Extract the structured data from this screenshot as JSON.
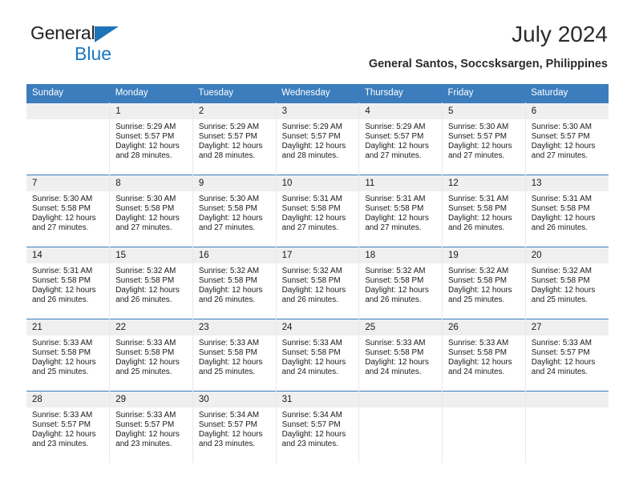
{
  "brand": {
    "name_part1": "General",
    "name_part2": "Blue",
    "triangle_color": "#1f73b7",
    "blue_color": "#1878c4"
  },
  "header": {
    "title": "July 2024",
    "subtitle": "General Santos, Soccsksargen, Philippines"
  },
  "theme": {
    "header_bg": "#3b7dbd",
    "header_text": "#ffffff",
    "daynum_bg": "#efefef",
    "row_border": "#3b7dbd"
  },
  "calendar": {
    "weekdays": [
      "Sunday",
      "Monday",
      "Tuesday",
      "Wednesday",
      "Thursday",
      "Friday",
      "Saturday"
    ],
    "labels": {
      "sunrise": "Sunrise:",
      "sunset": "Sunset:",
      "daylight": "Daylight:"
    },
    "weeks": [
      [
        {
          "day": "",
          "empty": true
        },
        {
          "day": "1",
          "sunrise": "Sunrise: 5:29 AM",
          "sunset": "Sunset: 5:57 PM",
          "daylight": "Daylight: 12 hours and 28 minutes."
        },
        {
          "day": "2",
          "sunrise": "Sunrise: 5:29 AM",
          "sunset": "Sunset: 5:57 PM",
          "daylight": "Daylight: 12 hours and 28 minutes."
        },
        {
          "day": "3",
          "sunrise": "Sunrise: 5:29 AM",
          "sunset": "Sunset: 5:57 PM",
          "daylight": "Daylight: 12 hours and 28 minutes."
        },
        {
          "day": "4",
          "sunrise": "Sunrise: 5:29 AM",
          "sunset": "Sunset: 5:57 PM",
          "daylight": "Daylight: 12 hours and 27 minutes."
        },
        {
          "day": "5",
          "sunrise": "Sunrise: 5:30 AM",
          "sunset": "Sunset: 5:57 PM",
          "daylight": "Daylight: 12 hours and 27 minutes."
        },
        {
          "day": "6",
          "sunrise": "Sunrise: 5:30 AM",
          "sunset": "Sunset: 5:57 PM",
          "daylight": "Daylight: 12 hours and 27 minutes."
        }
      ],
      [
        {
          "day": "7",
          "sunrise": "Sunrise: 5:30 AM",
          "sunset": "Sunset: 5:58 PM",
          "daylight": "Daylight: 12 hours and 27 minutes."
        },
        {
          "day": "8",
          "sunrise": "Sunrise: 5:30 AM",
          "sunset": "Sunset: 5:58 PM",
          "daylight": "Daylight: 12 hours and 27 minutes."
        },
        {
          "day": "9",
          "sunrise": "Sunrise: 5:30 AM",
          "sunset": "Sunset: 5:58 PM",
          "daylight": "Daylight: 12 hours and 27 minutes."
        },
        {
          "day": "10",
          "sunrise": "Sunrise: 5:31 AM",
          "sunset": "Sunset: 5:58 PM",
          "daylight": "Daylight: 12 hours and 27 minutes."
        },
        {
          "day": "11",
          "sunrise": "Sunrise: 5:31 AM",
          "sunset": "Sunset: 5:58 PM",
          "daylight": "Daylight: 12 hours and 27 minutes."
        },
        {
          "day": "12",
          "sunrise": "Sunrise: 5:31 AM",
          "sunset": "Sunset: 5:58 PM",
          "daylight": "Daylight: 12 hours and 26 minutes."
        },
        {
          "day": "13",
          "sunrise": "Sunrise: 5:31 AM",
          "sunset": "Sunset: 5:58 PM",
          "daylight": "Daylight: 12 hours and 26 minutes."
        }
      ],
      [
        {
          "day": "14",
          "sunrise": "Sunrise: 5:31 AM",
          "sunset": "Sunset: 5:58 PM",
          "daylight": "Daylight: 12 hours and 26 minutes."
        },
        {
          "day": "15",
          "sunrise": "Sunrise: 5:32 AM",
          "sunset": "Sunset: 5:58 PM",
          "daylight": "Daylight: 12 hours and 26 minutes."
        },
        {
          "day": "16",
          "sunrise": "Sunrise: 5:32 AM",
          "sunset": "Sunset: 5:58 PM",
          "daylight": "Daylight: 12 hours and 26 minutes."
        },
        {
          "day": "17",
          "sunrise": "Sunrise: 5:32 AM",
          "sunset": "Sunset: 5:58 PM",
          "daylight": "Daylight: 12 hours and 26 minutes."
        },
        {
          "day": "18",
          "sunrise": "Sunrise: 5:32 AM",
          "sunset": "Sunset: 5:58 PM",
          "daylight": "Daylight: 12 hours and 26 minutes."
        },
        {
          "day": "19",
          "sunrise": "Sunrise: 5:32 AM",
          "sunset": "Sunset: 5:58 PM",
          "daylight": "Daylight: 12 hours and 25 minutes."
        },
        {
          "day": "20",
          "sunrise": "Sunrise: 5:32 AM",
          "sunset": "Sunset: 5:58 PM",
          "daylight": "Daylight: 12 hours and 25 minutes."
        }
      ],
      [
        {
          "day": "21",
          "sunrise": "Sunrise: 5:33 AM",
          "sunset": "Sunset: 5:58 PM",
          "daylight": "Daylight: 12 hours and 25 minutes."
        },
        {
          "day": "22",
          "sunrise": "Sunrise: 5:33 AM",
          "sunset": "Sunset: 5:58 PM",
          "daylight": "Daylight: 12 hours and 25 minutes."
        },
        {
          "day": "23",
          "sunrise": "Sunrise: 5:33 AM",
          "sunset": "Sunset: 5:58 PM",
          "daylight": "Daylight: 12 hours and 25 minutes."
        },
        {
          "day": "24",
          "sunrise": "Sunrise: 5:33 AM",
          "sunset": "Sunset: 5:58 PM",
          "daylight": "Daylight: 12 hours and 24 minutes."
        },
        {
          "day": "25",
          "sunrise": "Sunrise: 5:33 AM",
          "sunset": "Sunset: 5:58 PM",
          "daylight": "Daylight: 12 hours and 24 minutes."
        },
        {
          "day": "26",
          "sunrise": "Sunrise: 5:33 AM",
          "sunset": "Sunset: 5:58 PM",
          "daylight": "Daylight: 12 hours and 24 minutes."
        },
        {
          "day": "27",
          "sunrise": "Sunrise: 5:33 AM",
          "sunset": "Sunset: 5:57 PM",
          "daylight": "Daylight: 12 hours and 24 minutes."
        }
      ],
      [
        {
          "day": "28",
          "sunrise": "Sunrise: 5:33 AM",
          "sunset": "Sunset: 5:57 PM",
          "daylight": "Daylight: 12 hours and 23 minutes."
        },
        {
          "day": "29",
          "sunrise": "Sunrise: 5:33 AM",
          "sunset": "Sunset: 5:57 PM",
          "daylight": "Daylight: 12 hours and 23 minutes."
        },
        {
          "day": "30",
          "sunrise": "Sunrise: 5:34 AM",
          "sunset": "Sunset: 5:57 PM",
          "daylight": "Daylight: 12 hours and 23 minutes."
        },
        {
          "day": "31",
          "sunrise": "Sunrise: 5:34 AM",
          "sunset": "Sunset: 5:57 PM",
          "daylight": "Daylight: 12 hours and 23 minutes."
        },
        {
          "day": "",
          "empty": true
        },
        {
          "day": "",
          "empty": true
        },
        {
          "day": "",
          "empty": true
        }
      ]
    ]
  }
}
